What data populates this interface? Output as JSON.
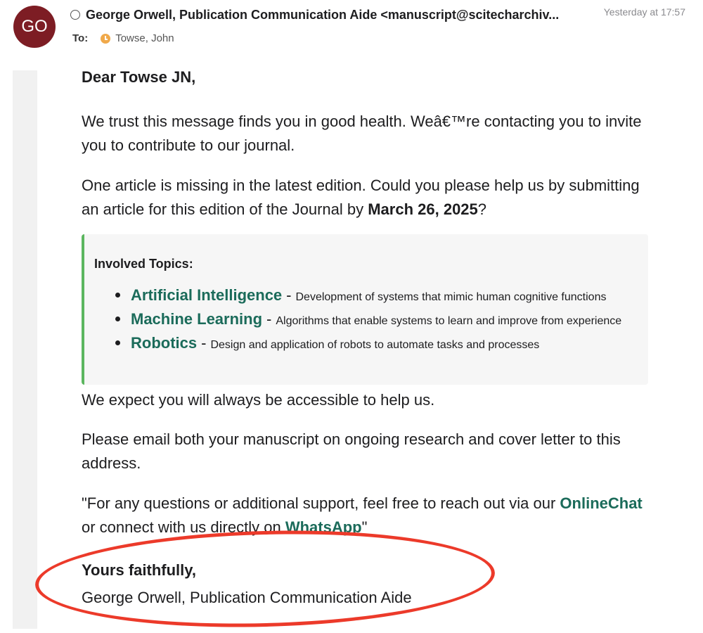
{
  "header": {
    "avatar_initials": "GO",
    "sender": "George Orwell, Publication Communication Aide <manuscript@scitecharchiv...",
    "date": "Yesterday at 17:57",
    "to_label": "To:",
    "recipient": "Towse, John"
  },
  "body": {
    "greeting": "Dear Towse JN,",
    "p1": "We trust this message finds you in good health. Weâ€™re contacting you to invite you to contribute to our journal.",
    "p2_text": "One article is missing in the latest edition. Could you please help us by submitting an article for this edition of the Journal by ",
    "p2_date": "March 26, 2025",
    "p2_end": "?",
    "topics_title": "Involved Topics:",
    "topics": [
      {
        "name": "Artificial Intelligence",
        "sep": "-",
        "desc": "Development of systems that mimic human cognitive functions"
      },
      {
        "name": "Machine Learning",
        "sep": "-",
        "desc": "Algorithms that enable systems to learn and improve from experience"
      },
      {
        "name": "Robotics",
        "sep": "-",
        "desc": "Design and application of robots to automate tasks and processes"
      }
    ],
    "p3": "We expect you will always be accessible to help us.",
    "p4": "Please email both your manuscript on ongoing research and cover letter to this address.",
    "p5_start": "\"For any questions or additional support, feel free to reach out via our ",
    "p5_link1": "OnlineChat",
    "p5_mid": " or connect with us directly on ",
    "p5_link2": "WhatsApp",
    "p5_end": "\"",
    "closing": "Yours faithfully,",
    "signature": "George Orwell, Publication Communication Aide"
  },
  "colors": {
    "avatar_bg": "#7d1d24",
    "link": "#1b6b5a",
    "topic_border": "#5bb65f",
    "highlight_ellipse": "#ec3a2a"
  }
}
